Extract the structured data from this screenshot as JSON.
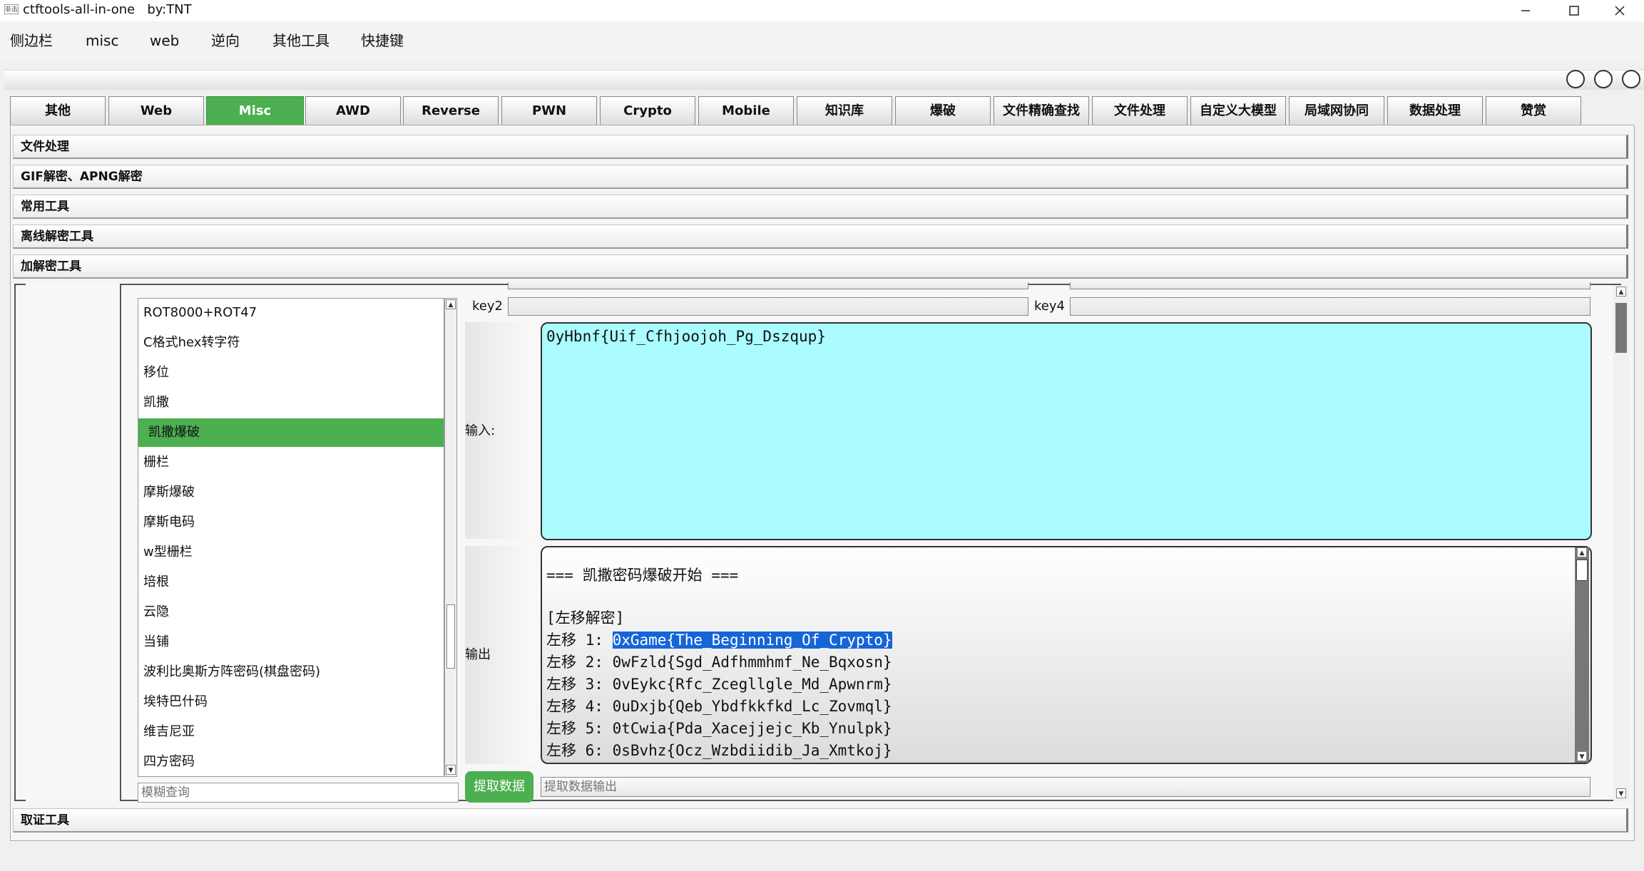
{
  "window": {
    "icon_text": "非击",
    "title": "ctftools-all-in-one   by:TNT"
  },
  "menu": [
    "侧边栏",
    "misc",
    "web",
    "逆向",
    "其他工具",
    "快捷键"
  ],
  "tabs": [
    {
      "label": "其他",
      "active": false
    },
    {
      "label": "Web",
      "active": false
    },
    {
      "label": "Misc",
      "active": true
    },
    {
      "label": "AWD",
      "active": false
    },
    {
      "label": "Reverse",
      "active": false
    },
    {
      "label": "PWN",
      "active": false
    },
    {
      "label": "Crypto",
      "active": false
    },
    {
      "label": "Mobile",
      "active": false
    },
    {
      "label": "知识库",
      "active": false
    },
    {
      "label": "爆破",
      "active": false
    },
    {
      "label": "文件精确查找",
      "active": false
    },
    {
      "label": "文件处理",
      "active": false
    },
    {
      "label": "自定义大模型",
      "active": false
    },
    {
      "label": "局域网协同",
      "active": false
    },
    {
      "label": "数据处理",
      "active": false
    },
    {
      "label": "赞赏",
      "active": false
    }
  ],
  "sections": [
    "文件处理",
    "GIF解密、APNG解密",
    "常用工具",
    "离线解密工具",
    "加解密工具"
  ],
  "tail_section": "取证工具",
  "cipher_list": {
    "items": [
      "ROT8000+ROT47",
      "C格式hex转字符",
      "移位",
      "凯撒",
      "凯撒爆破",
      "栅栏",
      "摩斯爆破",
      "摩斯电码",
      "w型栅栏",
      "培根",
      "云隐",
      "当铺",
      "波利比奥斯方阵密码(棋盘密码)",
      "埃特巴什码",
      "维吉尼亚",
      "四方密码"
    ],
    "selected": "凯撒爆破",
    "search_placeholder": "模糊查询"
  },
  "keys": {
    "key2_label": "key2",
    "key4_label": "key4",
    "key2_value": "",
    "key4_value": ""
  },
  "input": {
    "label": "输入:",
    "value": "0yHbnf{Uif_Cfhjoojoh_Pg_Dszqup}"
  },
  "output": {
    "label": "输出",
    "lines": [
      "=== 凯撒密码爆破开始 ===",
      "",
      "[左移解密]",
      "左移 1: 0xGame{The_Beginning_Of_Crypto}",
      "左移 2: 0wFzld{Sgd_Adfhmmhmf_Ne_Bqxosn}",
      "左移 3: 0vEykc{Rfc_Zcegllgle_Md_Apwnrm}",
      "左移 4: 0uDxjb{Qeb_Ybdfkkfkd_Lc_Zovmql}",
      "左移 5: 0tCwia{Pda_Xacejjejc_Kb_Ynulpk}",
      "左移 6: 0sBvhz{Ocz_Wzbdiidib_Ja_Xmtkoj}"
    ],
    "highlight": {
      "prefix": "左移 1: ",
      "text": "0xGame{The_Beginning_Of_Crypto}"
    }
  },
  "extract": {
    "button_label": "提取数据",
    "placeholder": "提取数据输出"
  },
  "colors": {
    "accent": "#4caf50",
    "input_bg": "#aafcff",
    "highlight": "#1565d8"
  }
}
